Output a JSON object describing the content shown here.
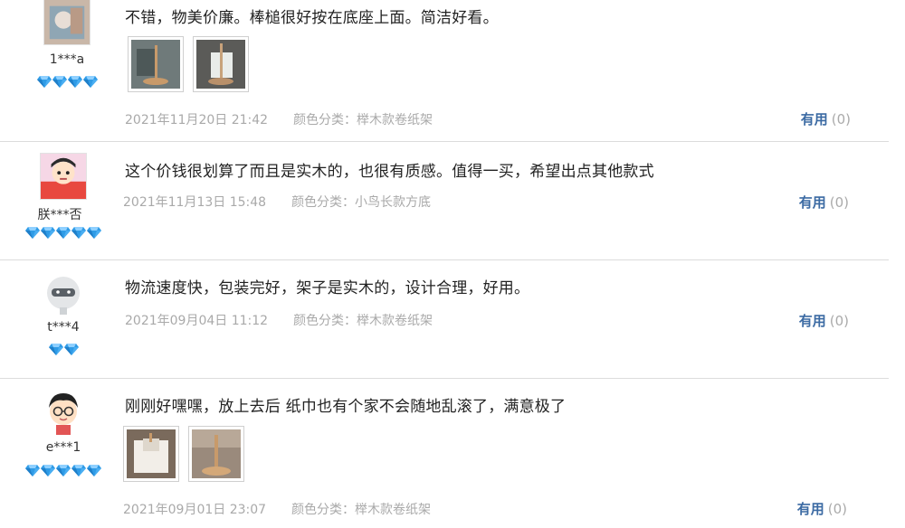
{
  "reviews": [
    {
      "nick": "1***a",
      "gems": 4,
      "text": "不错，物美价廉。棒槌很好按在底座上面。简洁好看。",
      "photos": [
        "photo-1",
        "photo-2"
      ],
      "date": "2021年11月20日 21:42",
      "sku": "颜色分类：榉木款卷纸架",
      "useful_label": "有用",
      "useful_count": "(0)"
    },
    {
      "nick": "朕***否",
      "gems": 5,
      "text": "这个价钱很划算了而且是实木的，也很有质感。值得一买，希望出点其他款式",
      "photos": [],
      "date": "2021年11月13日 15:48",
      "sku": "颜色分类：小鸟长款方底",
      "useful_label": "有用",
      "useful_count": "(0)"
    },
    {
      "nick": "t***4",
      "gems": 2,
      "text": "物流速度快，包装完好，架子是实木的，设计合理，好用。",
      "photos": [],
      "date": "2021年09月04日 11:12",
      "sku": "颜色分类：榉木款卷纸架",
      "useful_label": "有用",
      "useful_count": "(0)"
    },
    {
      "nick": "e***1",
      "gems": 5,
      "text": "刚刚好嘿嘿，放上去后 纸巾也有个家不会随地乱滚了，满意极了",
      "photos": [
        "photo-3",
        "photo-4"
      ],
      "date": "2021年09月01日 23:07",
      "sku": "颜色分类：榉木款卷纸架",
      "useful_label": "有用",
      "useful_count": "(0)"
    }
  ],
  "colors": {
    "useful_link": "#3b6aa3",
    "meta_text": "#a9a9a9",
    "gem": "#2f9be6"
  }
}
